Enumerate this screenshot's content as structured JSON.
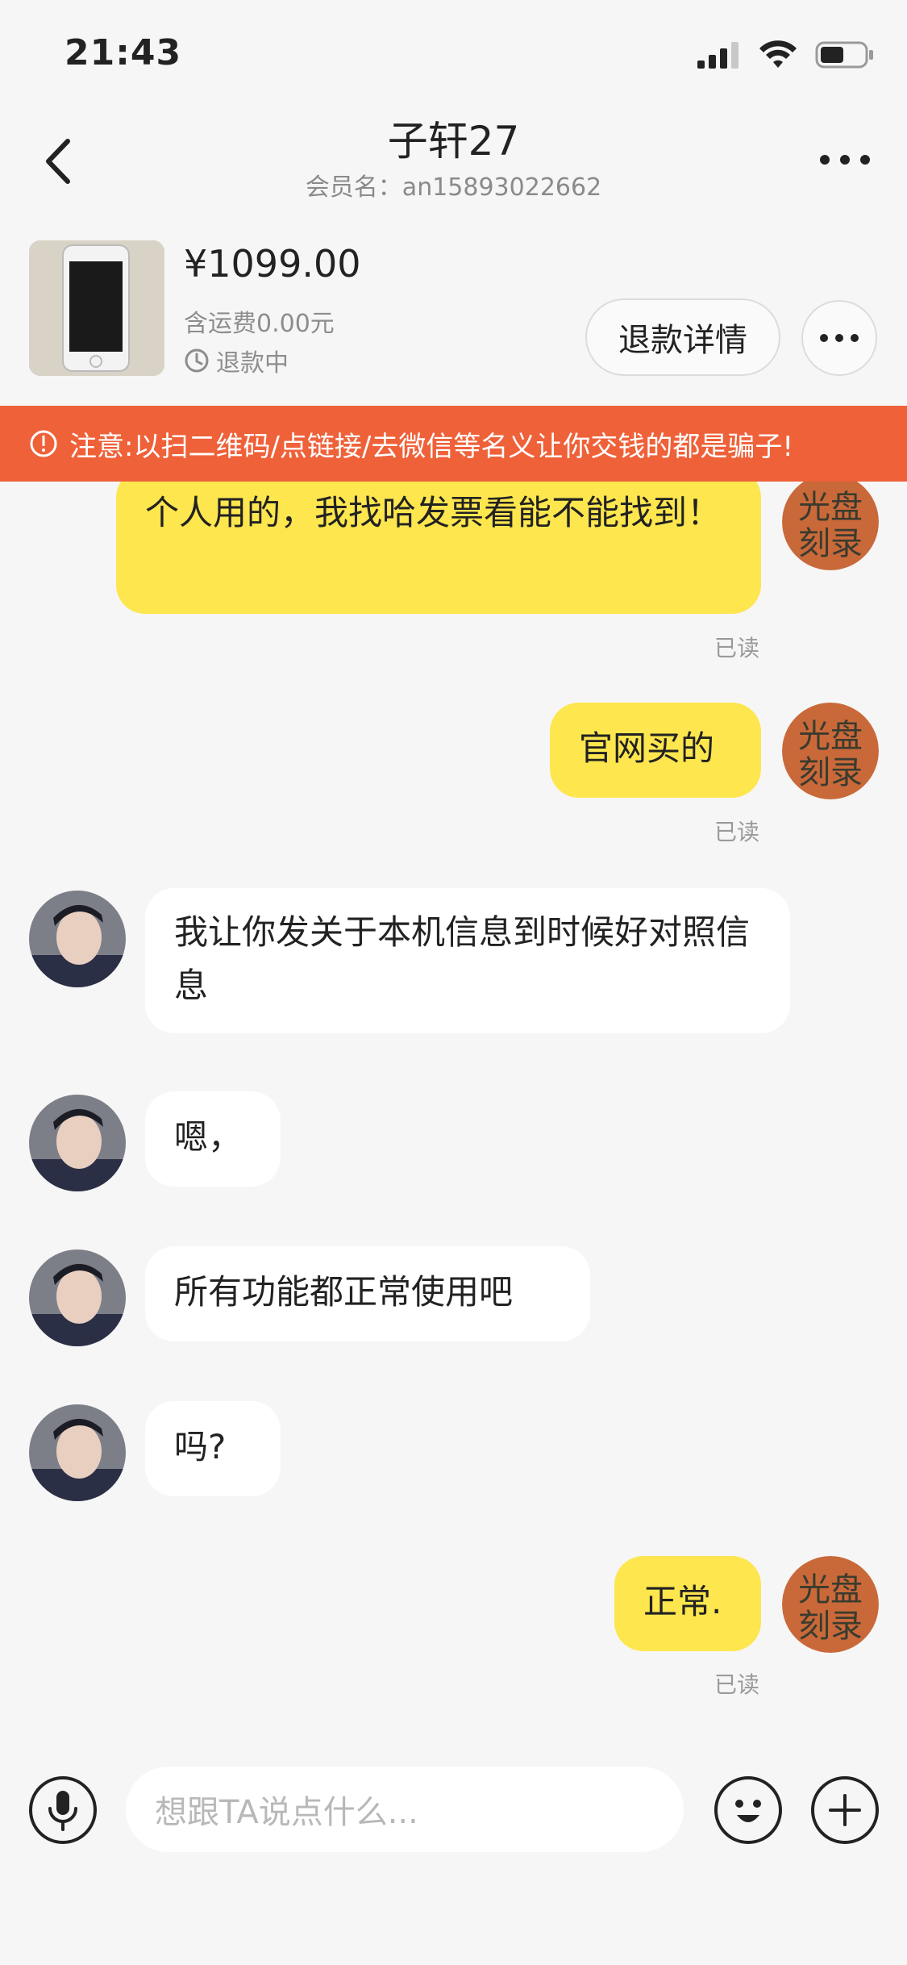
{
  "status": {
    "time": "21:43"
  },
  "nav": {
    "title": "子轩27",
    "subtitle": "会员名：an15893022662"
  },
  "product": {
    "price": "¥1099.00",
    "shipping": "含运费0.00元",
    "refund_state": "退款中",
    "refund_button": "退款详情"
  },
  "warning": {
    "text": "注意:以扫二维码/点链接/去微信等名义让你交钱的都是骗子!"
  },
  "messages": [
    {
      "from": "me",
      "text": "个人用的，我找哈发票看能不能找到！",
      "read": "已读",
      "avatar_text": "光盘刻录"
    },
    {
      "from": "me",
      "text": "官网买的",
      "read": "已读",
      "avatar_text": "光盘刻录"
    },
    {
      "from": "them",
      "text": "我让你发关于本机信息到时候好对照信息"
    },
    {
      "from": "them",
      "text": "嗯，"
    },
    {
      "from": "them",
      "text": "所有功能都正常使用吧"
    },
    {
      "from": "them",
      "text": "吗?"
    },
    {
      "from": "me",
      "text": "正常.",
      "read": "已读",
      "avatar_text": "光盘刻录"
    }
  ],
  "input": {
    "placeholder": "想跟TA说点什么..."
  },
  "icons": {
    "back": "chevron-left-icon",
    "more": "more-dots-icon",
    "clock": "clock-icon",
    "alert": "alert-circle-icon",
    "mic": "microphone-icon",
    "emoji": "emoji-icon",
    "plus": "plus-icon"
  },
  "colors": {
    "accent_bubble": "#fde64e",
    "warning_bg": "#ef6139"
  }
}
